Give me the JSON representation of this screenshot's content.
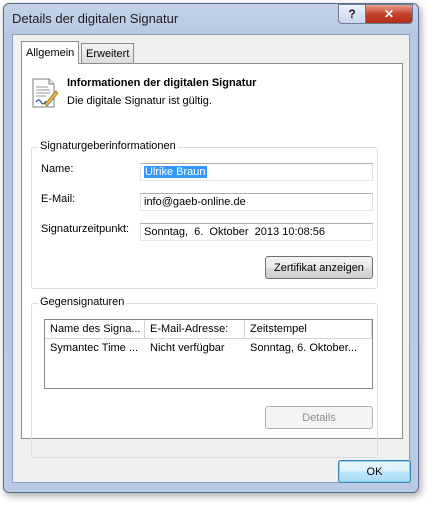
{
  "window": {
    "title": "Details der digitalen Signatur",
    "help_glyph": "?",
    "close_glyph": "✕"
  },
  "tabs": [
    {
      "label": "Allgemein"
    },
    {
      "label": "Erweitert"
    }
  ],
  "info": {
    "title": "Informationen der digitalen Signatur",
    "status": "Die digitale Signatur ist gültig."
  },
  "signer": {
    "group_label": "Signaturgeberinformationen",
    "name_label": "Name:",
    "name_value": "Ulrike Braun",
    "email_label": "E-Mail:",
    "email_value": "info@gaeb-online.de",
    "time_label": "Signaturzeitpunkt:",
    "time_value": "Sonntag,  6.  Oktober  2013 10:08:56",
    "cert_button": "Zertifikat anzeigen"
  },
  "countersig": {
    "group_label": "Gegensignaturen",
    "columns": [
      "Name des Signa...",
      "E-Mail-Adresse:",
      "Zeitstempel"
    ],
    "rows": [
      [
        "Symantec Time ...",
        "Nicht verfügbar",
        "Sonntag, 6. Oktober..."
      ]
    ],
    "details_button": "Details"
  },
  "footer": {
    "ok_button": "OK"
  }
}
